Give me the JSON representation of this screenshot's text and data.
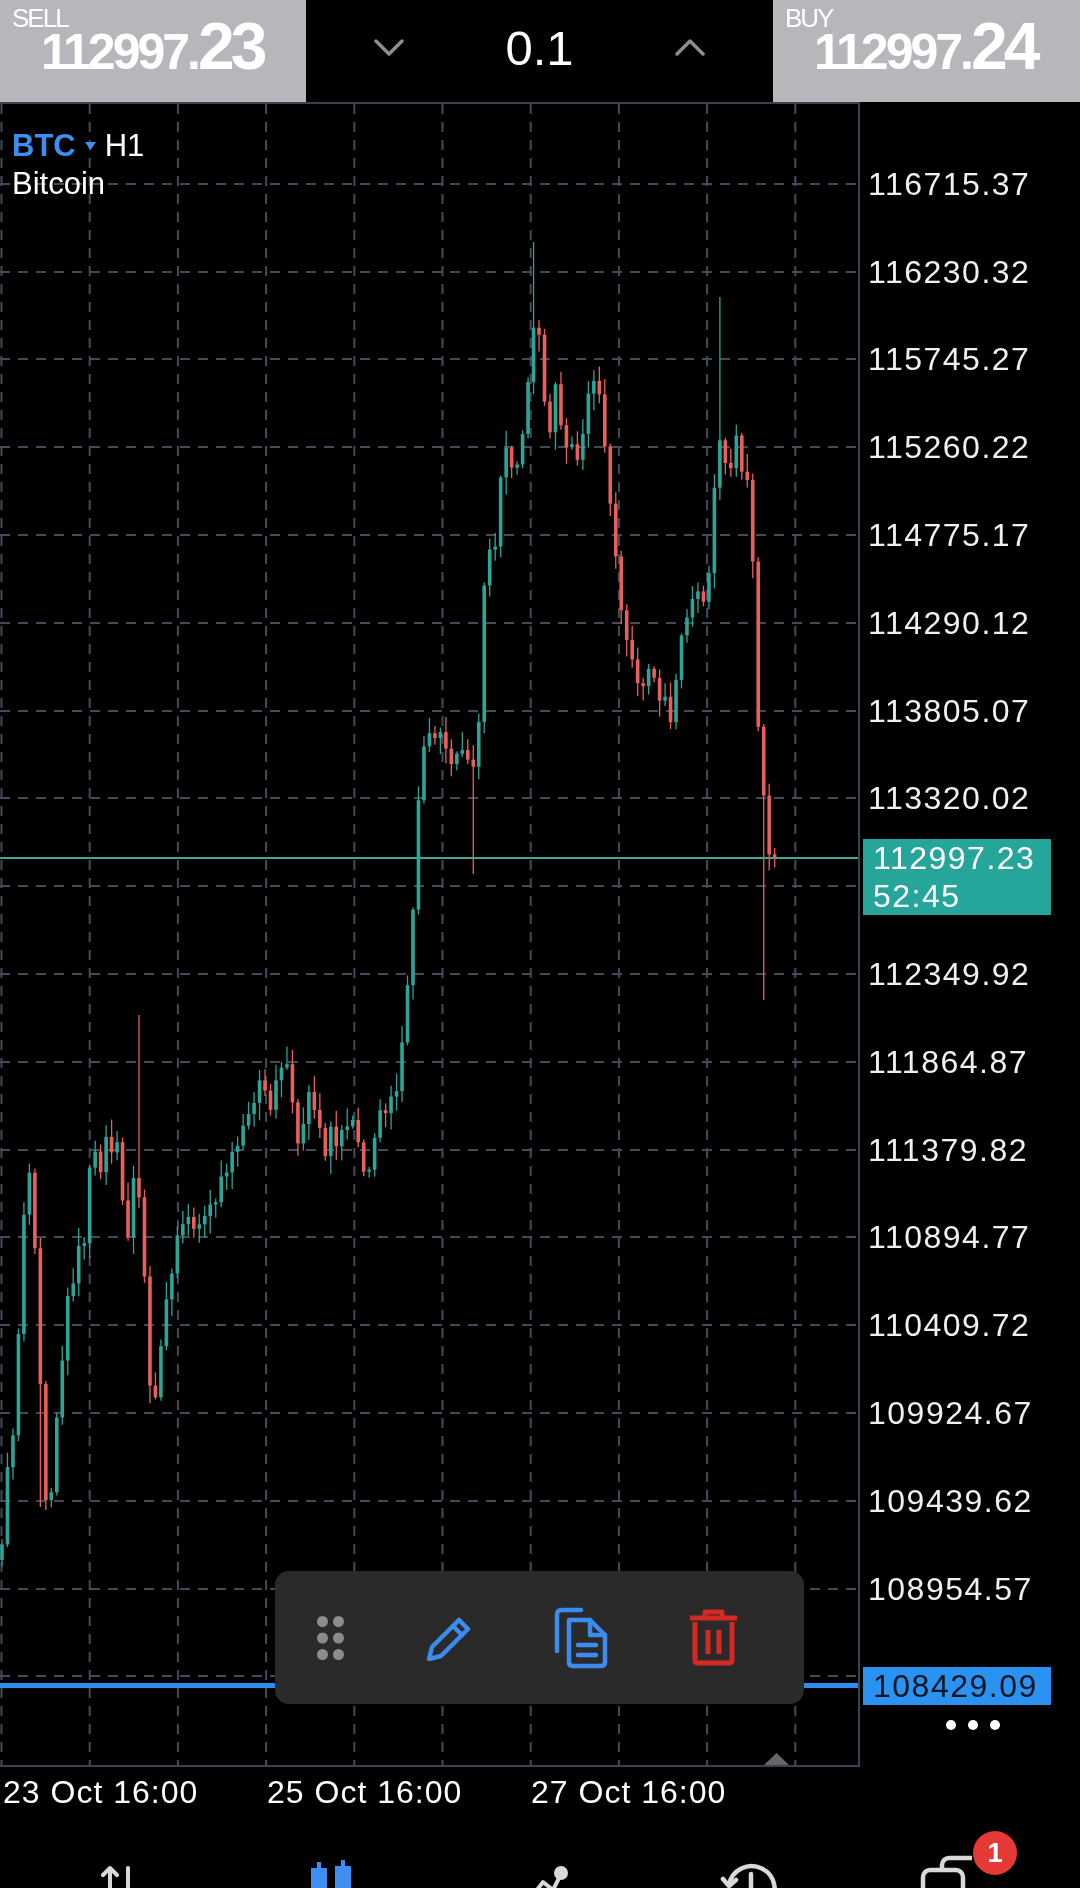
{
  "order_panel": {
    "sell": {
      "label": "SELL",
      "price_head": "112997.",
      "price_tail": "23"
    },
    "volume": "0.1",
    "buy": {
      "label": "BUY",
      "price_head": "112997.",
      "price_tail": "24"
    }
  },
  "chart": {
    "symbol": "BTC",
    "timeframe": "H1",
    "description": "Bitcoin",
    "price_axis": [
      {
        "kind": "tick",
        "text": "116715.37"
      },
      {
        "kind": "tick",
        "text": "116230.32"
      },
      {
        "kind": "tick",
        "text": "115745.27"
      },
      {
        "kind": "tick",
        "text": "115260.22"
      },
      {
        "kind": "tick",
        "text": "114775.17"
      },
      {
        "kind": "tick",
        "text": "114290.12"
      },
      {
        "kind": "tick",
        "text": "113805.07"
      },
      {
        "kind": "tick",
        "text": "113320.02"
      },
      {
        "kind": "bid",
        "text": "112997.23",
        "countdown": "52:45"
      },
      {
        "kind": "tick",
        "text": "112349.92"
      },
      {
        "kind": "tick",
        "text": "111864.87"
      },
      {
        "kind": "tick",
        "text": "111379.82"
      },
      {
        "kind": "tick",
        "text": "110894.77"
      },
      {
        "kind": "tick",
        "text": "110409.72"
      },
      {
        "kind": "tick",
        "text": "109924.67"
      },
      {
        "kind": "tick",
        "text": "109439.62"
      },
      {
        "kind": "tick",
        "text": "108954.57"
      },
      {
        "kind": "line",
        "text": "108429.09"
      }
    ],
    "time_axis": [
      "23 Oct 16:00",
      "25 Oct 16:00",
      "27 Oct 16:00"
    ]
  },
  "bottom_nav": {
    "items": [
      {
        "selected": false
      },
      {
        "selected": true
      },
      {
        "selected": false
      },
      {
        "selected": false
      },
      {
        "selected": false,
        "badge": "1"
      }
    ]
  }
}
